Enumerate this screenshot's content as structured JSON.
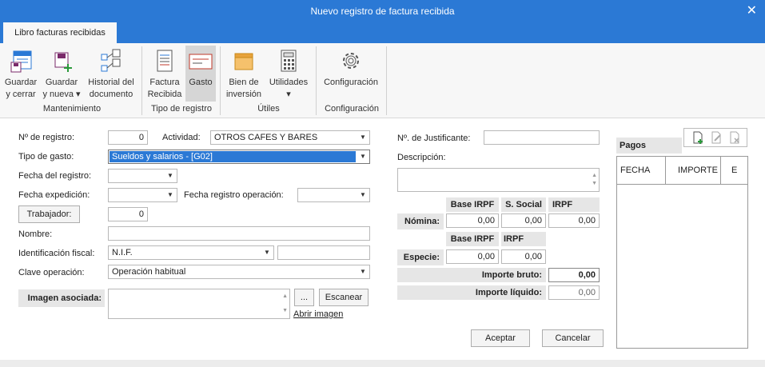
{
  "window": {
    "title": "Nuevo registro de factura recibida",
    "close": "✕"
  },
  "tab": {
    "label": "Libro facturas recibidas"
  },
  "ribbon": {
    "buttons": [
      {
        "l1": "Guardar",
        "l2": "y cerrar"
      },
      {
        "l1": "Guardar",
        "l2": "y nueva ▾"
      },
      {
        "l1": "Historial del",
        "l2": "documento"
      },
      {
        "l1": "Factura",
        "l2": "Recibida"
      },
      {
        "l1": "Gasto",
        "l2": ""
      },
      {
        "l1": "Bien de",
        "l2": "inversión"
      },
      {
        "l1": "Utilidades",
        "l2": "▾"
      },
      {
        "l1": "Configuración",
        "l2": ""
      }
    ],
    "groups": [
      "Mantenimiento",
      "Tipo de registro",
      "Útiles",
      "Configuración"
    ]
  },
  "form": {
    "registro_label": "Nº de registro:",
    "registro_value": "0",
    "actividad_label": "Actividad:",
    "actividad_value": "OTROS CAFES Y BARES",
    "tipo_gasto_label": "Tipo de gasto:",
    "tipo_gasto_value": "Sueldos y salarios - [G02]",
    "fecha_registro_label": "Fecha del registro:",
    "fecha_expedicion_label": "Fecha expedición:",
    "fecha_reg_op_label": "Fecha registro operación:",
    "trabajador_button": "Trabajador:",
    "trabajador_value": "0",
    "nombre_label": "Nombre:",
    "ident_label": "Identificación fiscal:",
    "ident_value": "N.I.F.",
    "clave_label": "Clave operación:",
    "clave_value": "Operación habitual",
    "imagen_label": "Imagen asociada:",
    "browse_button": "...",
    "escanear_button": "Escanear",
    "abrir_imagen_link": "Abrir imagen"
  },
  "middle": {
    "justificante_label": "Nº. de Justificante:",
    "descripcion_label": "Descripción:",
    "nomina_headers": [
      "Base IRPF",
      "S. Social",
      "IRPF"
    ],
    "nomina_label": "Nómina:",
    "nomina_values": [
      "0,00",
      "0,00",
      "0,00"
    ],
    "especie_headers": [
      "Base IRPF",
      "IRPF"
    ],
    "especie_label": "Especie:",
    "especie_values": [
      "0,00",
      "0,00"
    ],
    "bruto_label": "Importe bruto:",
    "bruto_value": "0,00",
    "liquido_label": "Importe líquido:",
    "liquido_value": "0,00"
  },
  "pagos": {
    "title": "Pagos",
    "columns": [
      "FECHA",
      "IMPORTE",
      "E"
    ]
  },
  "footer": {
    "aceptar": "Aceptar",
    "cancelar": "Cancelar"
  }
}
